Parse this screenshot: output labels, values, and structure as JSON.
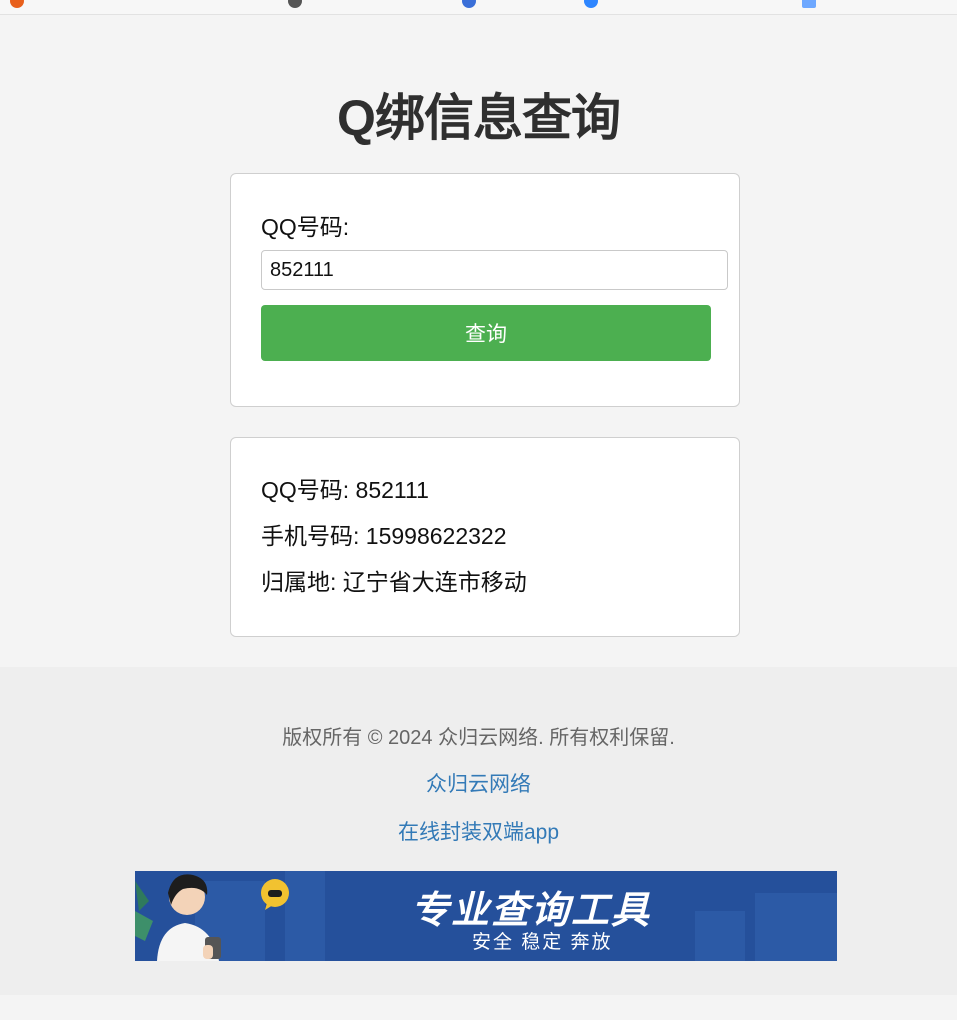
{
  "page": {
    "title": "Q绑信息查询"
  },
  "form": {
    "qq_label": "QQ号码:",
    "qq_value": "852111",
    "submit_label": "查询"
  },
  "result": {
    "qq_line": "QQ号码: 852111",
    "phone_line": "手机号码: 15998622322",
    "location_line": "归属地: 辽宁省大连市移动"
  },
  "footer": {
    "copyright": "版权所有 © 2024 众归云网络. 所有权利保留.",
    "link1": "众归云网络",
    "link2": "在线封装双端app",
    "banner_title": "专业查询工具",
    "banner_subtitle": "安全 稳定 奔放"
  },
  "colors": {
    "button": "#4caf50",
    "link": "#337ab7",
    "banner": "#25509b"
  }
}
